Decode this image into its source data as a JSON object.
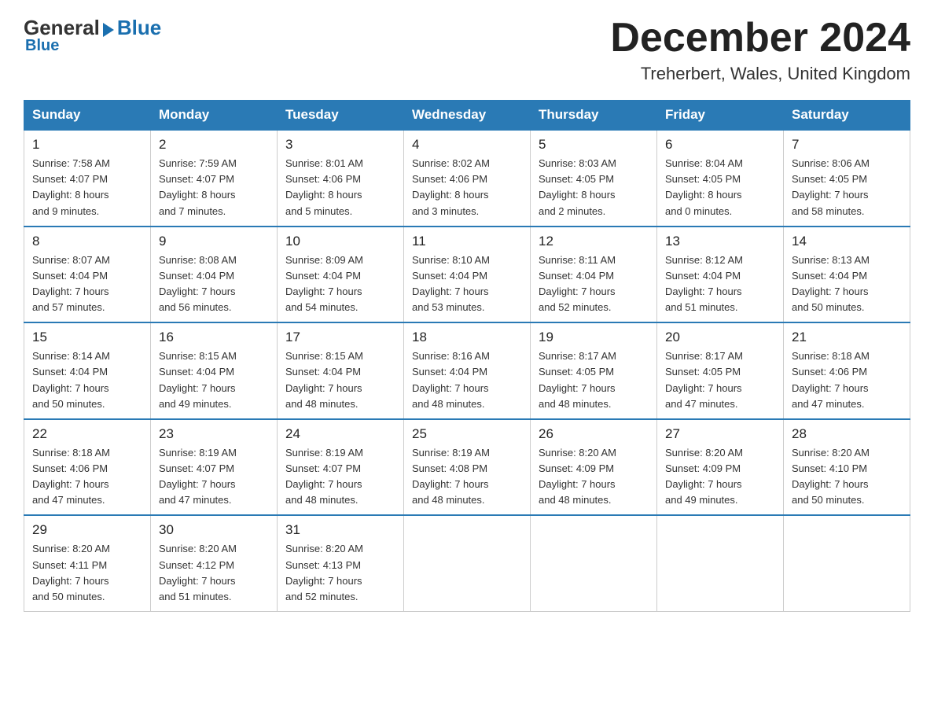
{
  "header": {
    "logo_general": "General",
    "logo_blue": "Blue",
    "month_title": "December 2024",
    "location": "Treherbert, Wales, United Kingdom"
  },
  "weekdays": [
    "Sunday",
    "Monday",
    "Tuesday",
    "Wednesday",
    "Thursday",
    "Friday",
    "Saturday"
  ],
  "weeks": [
    [
      {
        "day": "1",
        "sunrise": "7:58 AM",
        "sunset": "4:07 PM",
        "daylight": "8 hours and 9 minutes."
      },
      {
        "day": "2",
        "sunrise": "7:59 AM",
        "sunset": "4:07 PM",
        "daylight": "8 hours and 7 minutes."
      },
      {
        "day": "3",
        "sunrise": "8:01 AM",
        "sunset": "4:06 PM",
        "daylight": "8 hours and 5 minutes."
      },
      {
        "day": "4",
        "sunrise": "8:02 AM",
        "sunset": "4:06 PM",
        "daylight": "8 hours and 3 minutes."
      },
      {
        "day": "5",
        "sunrise": "8:03 AM",
        "sunset": "4:05 PM",
        "daylight": "8 hours and 2 minutes."
      },
      {
        "day": "6",
        "sunrise": "8:04 AM",
        "sunset": "4:05 PM",
        "daylight": "8 hours and 0 minutes."
      },
      {
        "day": "7",
        "sunrise": "8:06 AM",
        "sunset": "4:05 PM",
        "daylight": "7 hours and 58 minutes."
      }
    ],
    [
      {
        "day": "8",
        "sunrise": "8:07 AM",
        "sunset": "4:04 PM",
        "daylight": "7 hours and 57 minutes."
      },
      {
        "day": "9",
        "sunrise": "8:08 AM",
        "sunset": "4:04 PM",
        "daylight": "7 hours and 56 minutes."
      },
      {
        "day": "10",
        "sunrise": "8:09 AM",
        "sunset": "4:04 PM",
        "daylight": "7 hours and 54 minutes."
      },
      {
        "day": "11",
        "sunrise": "8:10 AM",
        "sunset": "4:04 PM",
        "daylight": "7 hours and 53 minutes."
      },
      {
        "day": "12",
        "sunrise": "8:11 AM",
        "sunset": "4:04 PM",
        "daylight": "7 hours and 52 minutes."
      },
      {
        "day": "13",
        "sunrise": "8:12 AM",
        "sunset": "4:04 PM",
        "daylight": "7 hours and 51 minutes."
      },
      {
        "day": "14",
        "sunrise": "8:13 AM",
        "sunset": "4:04 PM",
        "daylight": "7 hours and 50 minutes."
      }
    ],
    [
      {
        "day": "15",
        "sunrise": "8:14 AM",
        "sunset": "4:04 PM",
        "daylight": "7 hours and 50 minutes."
      },
      {
        "day": "16",
        "sunrise": "8:15 AM",
        "sunset": "4:04 PM",
        "daylight": "7 hours and 49 minutes."
      },
      {
        "day": "17",
        "sunrise": "8:15 AM",
        "sunset": "4:04 PM",
        "daylight": "7 hours and 48 minutes."
      },
      {
        "day": "18",
        "sunrise": "8:16 AM",
        "sunset": "4:04 PM",
        "daylight": "7 hours and 48 minutes."
      },
      {
        "day": "19",
        "sunrise": "8:17 AM",
        "sunset": "4:05 PM",
        "daylight": "7 hours and 48 minutes."
      },
      {
        "day": "20",
        "sunrise": "8:17 AM",
        "sunset": "4:05 PM",
        "daylight": "7 hours and 47 minutes."
      },
      {
        "day": "21",
        "sunrise": "8:18 AM",
        "sunset": "4:06 PM",
        "daylight": "7 hours and 47 minutes."
      }
    ],
    [
      {
        "day": "22",
        "sunrise": "8:18 AM",
        "sunset": "4:06 PM",
        "daylight": "7 hours and 47 minutes."
      },
      {
        "day": "23",
        "sunrise": "8:19 AM",
        "sunset": "4:07 PM",
        "daylight": "7 hours and 47 minutes."
      },
      {
        "day": "24",
        "sunrise": "8:19 AM",
        "sunset": "4:07 PM",
        "daylight": "7 hours and 48 minutes."
      },
      {
        "day": "25",
        "sunrise": "8:19 AM",
        "sunset": "4:08 PM",
        "daylight": "7 hours and 48 minutes."
      },
      {
        "day": "26",
        "sunrise": "8:20 AM",
        "sunset": "4:09 PM",
        "daylight": "7 hours and 48 minutes."
      },
      {
        "day": "27",
        "sunrise": "8:20 AM",
        "sunset": "4:09 PM",
        "daylight": "7 hours and 49 minutes."
      },
      {
        "day": "28",
        "sunrise": "8:20 AM",
        "sunset": "4:10 PM",
        "daylight": "7 hours and 50 minutes."
      }
    ],
    [
      {
        "day": "29",
        "sunrise": "8:20 AM",
        "sunset": "4:11 PM",
        "daylight": "7 hours and 50 minutes."
      },
      {
        "day": "30",
        "sunrise": "8:20 AM",
        "sunset": "4:12 PM",
        "daylight": "7 hours and 51 minutes."
      },
      {
        "day": "31",
        "sunrise": "8:20 AM",
        "sunset": "4:13 PM",
        "daylight": "7 hours and 52 minutes."
      },
      null,
      null,
      null,
      null
    ]
  ],
  "labels": {
    "sunrise": "Sunrise:",
    "sunset": "Sunset:",
    "daylight": "Daylight:"
  }
}
